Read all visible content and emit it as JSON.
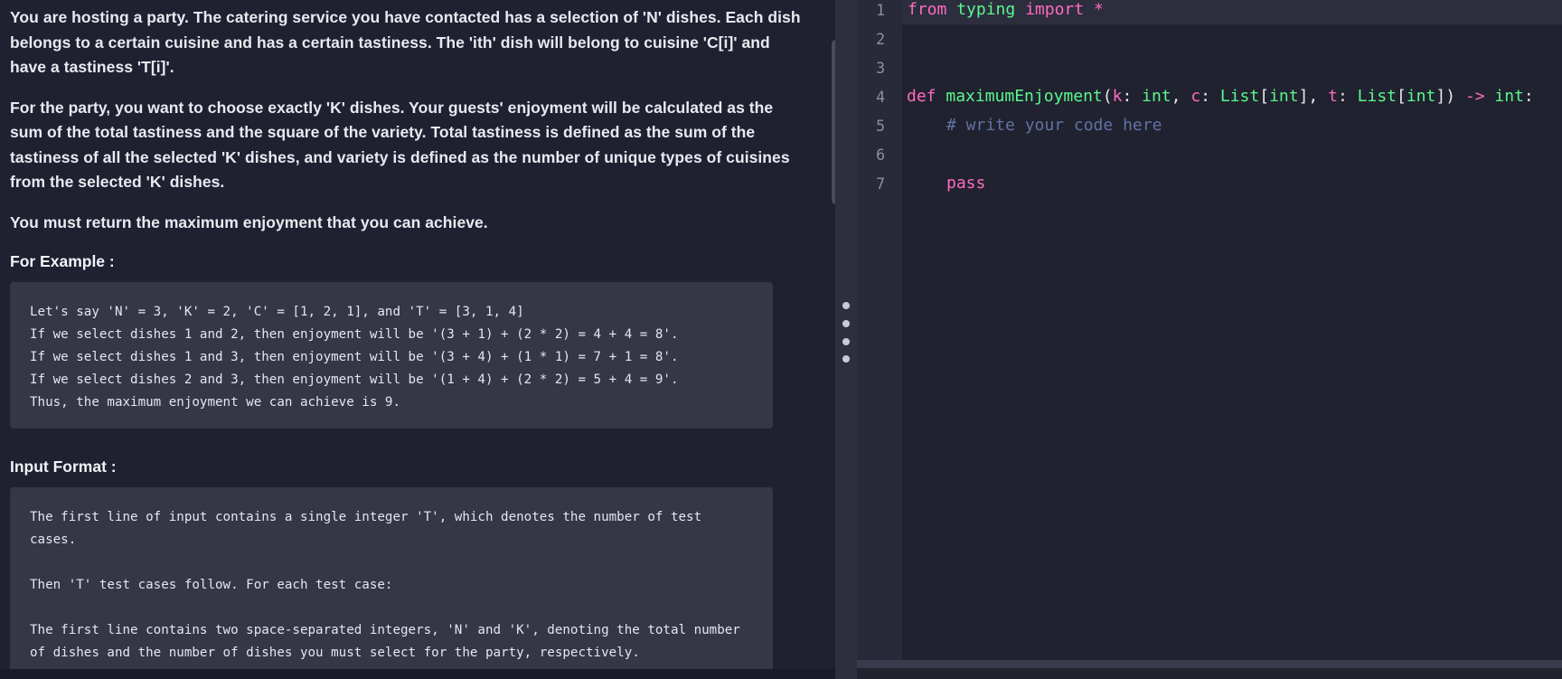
{
  "problem": {
    "paragraphs": [
      "You are hosting a party. The catering service you have contacted has a selection of 'N' dishes. Each dish belongs to a certain cuisine and has a certain tastiness. The 'ith' dish will belong to cuisine 'C[i]' and have a tastiness 'T[i]'.",
      "For the party, you want to choose exactly 'K' dishes. Your guests' enjoyment will be calculated as the sum of the total tastiness and the square of the variety. Total tastiness is defined as the sum of the tastiness of all the selected 'K' dishes, and variety is defined as the number of unique types of cuisines from the selected 'K' dishes.",
      "You must return the maximum enjoyment that you can achieve."
    ],
    "example_title": "For Example :",
    "example_lines": [
      "Let's say 'N' = 3, 'K' = 2, 'C' = [1, 2, 1], and 'T' = [3, 1, 4]",
      "If we select dishes 1 and 2, then enjoyment will be '(3 + 1) + (2 * 2) = 4 + 4 = 8'.",
      "If we select dishes 1 and 3, then enjoyment will be '(3 + 4) + (1 * 1) = 7 + 1 = 8'.",
      "If we select dishes 2 and 3, then enjoyment will be '(1 + 4) + (2 * 2) = 5 + 4 = 9'.",
      "Thus, the maximum enjoyment we can achieve is 9."
    ],
    "input_title": "Input Format :",
    "input_lines": [
      "The first line of input contains a single integer 'T', which denotes the number of test cases.",
      "Then 'T' test cases follow. For each test case:",
      "The first line contains two space-separated integers, 'N' and 'K', denoting the total number of dishes and the number of dishes you must select for the party, respectively."
    ]
  },
  "editor": {
    "line_numbers": [
      "1",
      "2",
      "3",
      "4",
      "5",
      "6",
      "7"
    ],
    "line1": {
      "kw_from": "from",
      "module": "typing",
      "kw_import": "import",
      "star": "*"
    },
    "line4": {
      "kw_def": "def",
      "fn_name": "maximumEnjoyment",
      "open": "(",
      "p_k": "k",
      "colon1": ": ",
      "t_int1": "int",
      "comma1": ", ",
      "p_c": "c",
      "colon2": ": ",
      "t_list1": "List",
      "br_open1": "[",
      "t_int2": "int",
      "br_close1": "]",
      "comma2": ", ",
      "p_t": "t",
      "colon3": ": ",
      "t_list2": "List",
      "br_open2": "[",
      "t_int3": "int",
      "br_close2": "])",
      "arrow": " -> ",
      "t_int4": "int",
      "colon_end": ":"
    },
    "line5_comment": "# write your code here",
    "line7_pass": "pass"
  }
}
